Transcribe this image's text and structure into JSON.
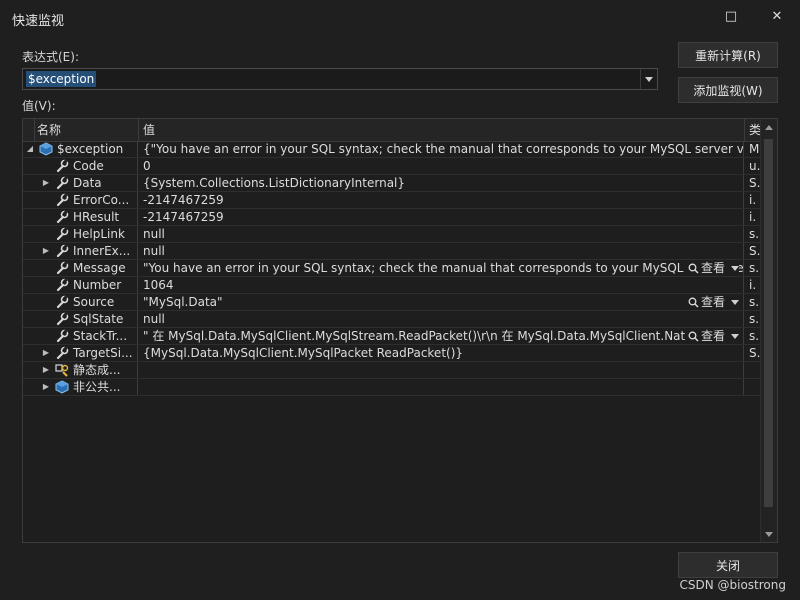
{
  "window": {
    "title": "快速监视",
    "minimize": "□",
    "close": "✕"
  },
  "expression": {
    "label": "表达式(E):",
    "value": "$exception"
  },
  "buttons": {
    "reevaluate": "重新计算(R)",
    "add_watch": "添加监视(W)",
    "close": "关闭"
  },
  "values_label": "值(V):",
  "columns": {
    "name": "名称",
    "value": "值",
    "type": "类"
  },
  "rows": [
    {
      "name": "$exception",
      "value": "{\"You have an error in your SQL syntax; check the manual that corresponds to your MySQL server version for the ...",
      "type": "M",
      "indent": 0,
      "expander": "◢",
      "icon": "object",
      "view": ""
    },
    {
      "name": "Code",
      "value": "0",
      "type": "u.",
      "indent": 1,
      "expander": "",
      "icon": "wrench",
      "view": ""
    },
    {
      "name": "Data",
      "value": "{System.Collections.ListDictionaryInternal}",
      "type": "S.",
      "indent": 1,
      "expander": "▶",
      "icon": "wrench",
      "view": ""
    },
    {
      "name": "ErrorCo...",
      "value": "-2147467259",
      "type": "i.",
      "indent": 1,
      "expander": "",
      "icon": "wrench",
      "view": ""
    },
    {
      "name": "HResult",
      "value": "-2147467259",
      "type": "i.",
      "indent": 1,
      "expander": "",
      "icon": "wrench",
      "view": ""
    },
    {
      "name": "HelpLink",
      "value": "null",
      "type": "s.",
      "indent": 1,
      "expander": "",
      "icon": "wrench",
      "view": ""
    },
    {
      "name": "InnerEx...",
      "value": "null",
      "type": "S.",
      "indent": 1,
      "expander": "▶",
      "icon": "wrench",
      "view": ""
    },
    {
      "name": "Message",
      "value": "\"You have an error in your SQL syntax; check the manual that corresponds to your MySQL server versi...",
      "type": "s.",
      "indent": 1,
      "expander": "",
      "icon": "wrench",
      "view": "查看"
    },
    {
      "name": "Number",
      "value": "1064",
      "type": "i.",
      "indent": 1,
      "expander": "",
      "icon": "wrench",
      "view": ""
    },
    {
      "name": "Source",
      "value": "\"MySql.Data\"",
      "type": "s.",
      "indent": 1,
      "expander": "",
      "icon": "wrench",
      "view": "查看"
    },
    {
      "name": "SqlState",
      "value": "null",
      "type": "s.",
      "indent": 1,
      "expander": "",
      "icon": "wrench",
      "view": ""
    },
    {
      "name": "StackTr...",
      "value": "\"   在 MySql.Data.MySqlClient.MySqlStream.ReadPacket()\\r\\n   在 MySql.Data.MySqlClient.NativeDriv...",
      "type": "s.",
      "indent": 1,
      "expander": "",
      "icon": "wrench",
      "view": "查看"
    },
    {
      "name": "TargetSi...",
      "value": "{MySql.Data.MySqlClient.MySqlPacket ReadPacket()}",
      "type": "S.",
      "indent": 1,
      "expander": "▶",
      "icon": "wrench",
      "view": ""
    },
    {
      "name": "静态成...",
      "value": "",
      "type": "",
      "indent": 1,
      "expander": "▶",
      "icon": "static",
      "view": ""
    },
    {
      "name": "非公共...",
      "value": "",
      "type": "",
      "indent": 1,
      "expander": "▶",
      "icon": "object",
      "view": ""
    }
  ],
  "watermark": "CSDN @biostrong"
}
